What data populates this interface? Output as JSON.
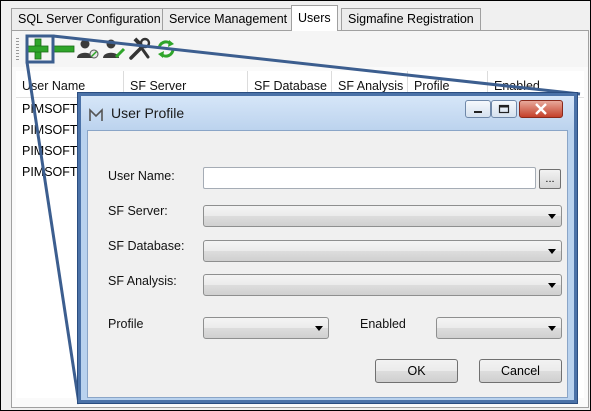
{
  "tabs": [
    {
      "label": "SQL Server Configuration",
      "active": false
    },
    {
      "label": "Service Management",
      "active": false
    },
    {
      "label": "Users",
      "active": true
    },
    {
      "label": "Sigmafine Registration",
      "active": false
    }
  ],
  "toolbar": {
    "icons": [
      "add-user-icon",
      "remove-user-icon",
      "user-permission-icon",
      "user-edit-icon",
      "tools-icon",
      "refresh-icon"
    ]
  },
  "grid": {
    "columns": [
      "User Name",
      "SF Server",
      "SF Database",
      "SF Analysis",
      "Profile",
      "Enabled"
    ],
    "rows": [
      {
        "user_name": "PIMSOFT"
      },
      {
        "user_name": "PIMSOFT"
      },
      {
        "user_name": "PIMSOFT"
      },
      {
        "user_name": "PIMSOFT"
      }
    ]
  },
  "dialog": {
    "title": "User Profile",
    "user_name_label": "User Name:",
    "user_name_value": "",
    "browse_label": "...",
    "sf_server_label": "SF Server:",
    "sf_server_value": "",
    "sf_database_label": "SF Database:",
    "sf_database_value": "",
    "sf_analysis_label": "SF Analysis:",
    "sf_analysis_value": "",
    "profile_label": "Profile",
    "profile_value": "",
    "enabled_label": "Enabled",
    "enabled_value": "",
    "ok_label": "OK",
    "cancel_label": "Cancel"
  },
  "colors": {
    "callout_line": "#3c5e8f",
    "add_icon": "#2fa52a",
    "remove_icon": "#2fa52a",
    "dialog_border": "#4b72a8",
    "close_button": "#c4402a"
  }
}
